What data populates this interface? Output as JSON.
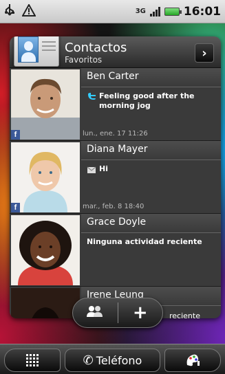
{
  "status_bar": {
    "usb_icon": "usb-icon",
    "warning_icon": "warning-icon",
    "network": "3G",
    "time": "16:01"
  },
  "widget": {
    "title": "Contactos",
    "subtitle": "Favoritos",
    "contacts": [
      {
        "name": "Ben Carter",
        "status_icon": "twitter-icon",
        "status": "Feeling good after the morning jog",
        "timestamp": "lun., ene. 17 11:26",
        "badge": "f"
      },
      {
        "name": "Diana Mayer",
        "status_icon": "mail-icon",
        "status": "Hi",
        "timestamp": "mar., feb. 8 18:40",
        "badge": "f"
      },
      {
        "name": "Grace Doyle",
        "status": "Ninguna actividad reciente",
        "timestamp": ""
      },
      {
        "name": "Irene Leung",
        "status": "reciente",
        "timestamp": ""
      }
    ]
  },
  "actions": {
    "group_icon": "people-icon",
    "add": "+"
  },
  "dock": {
    "apps_icon": "app-grid-icon",
    "phone_label": "Teléfono",
    "personalize_icon": "personalize-icon"
  },
  "colors": {
    "facebook": "#3b5998",
    "twitter": "#33ccff",
    "panel": "#3a3a3a"
  }
}
